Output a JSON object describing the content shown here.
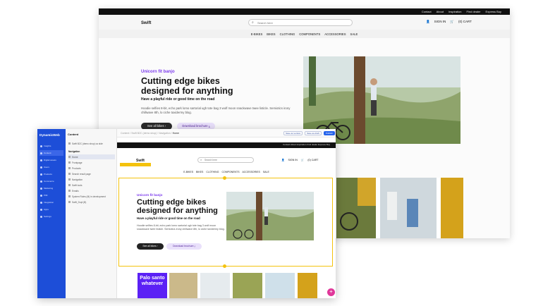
{
  "store": {
    "toplinks": [
      "Contact",
      "About",
      "Inspiration",
      "Find dealer",
      "Express Buy"
    ],
    "logo": "Swift",
    "search_placeholder": "Search here",
    "sign_in": "SIGN IN",
    "cart": "(0) CART",
    "nav": [
      "E-BIKES",
      "BIKES",
      "CLOTHING",
      "COMPONENTS",
      "ACCESSORIES",
      "SALE"
    ],
    "eyebrow": "Unicorn fit banjo",
    "title": "Cutting edge bikes designed for anything",
    "subtitle": "Have a playful ride or good time on the road",
    "body": "Hoodie selfies 8-bit, echo park lomo sartorial ugh tote bag 3 wolf moon snackwave twee listicle. Semiotics irony chillwave 8th, lo ciche taxidermy blog.",
    "btn_primary": "See all bikes",
    "btn_secondary": "Download brochure"
  },
  "cms": {
    "brand": "DynamicWeb",
    "menu": [
      "Insights",
      "Content",
      "Digital assets",
      "Users",
      "Products",
      "Commerce",
      "Marketing",
      "PIM",
      "Integration",
      "Apps",
      "Settings"
    ],
    "tree_header": "Content",
    "tree_site": "Swift B2C (demo shop) us side",
    "tree_nav": "Navigation",
    "tree_items": [
      "Home",
      "Frontpage",
      "Products",
      "Search result page",
      "Navigation",
      "Swift tools",
      "Emails",
      "System Roles (M) in development",
      "Swift_Dupl (B)"
    ],
    "crumb": [
      "Content",
      "Swift B2C (demo shop)",
      "Navigation",
      "Home"
    ],
    "crumb_current": "Home",
    "toolbar": {
      "btn_a": "Save as version",
      "btn_b": "Save as draft",
      "btn_c": "Publish"
    },
    "preview": {
      "toplinks": "Contact   About   Inspiration   Find dealer   Express Buy",
      "logo": "Swift",
      "search_placeholder": "Search here",
      "sign_in": "SIGN IN",
      "cart": "(0) CART",
      "nav": [
        "E-BIKES",
        "BIKES",
        "CLOTHING",
        "COMPONENTS",
        "ACCESSORIES",
        "SALE"
      ],
      "eyebrow": "Unicorn fit banjo",
      "title": "Cutting edge bikes designed for anything",
      "subtitle": "Have a playful ride or good time on the road",
      "body": "Hoodie selfies 8-bit, echo park lomo sartorial ugh tote bag 3 wolf moon snackwave twee listicle. Semiotics irony chillwave 8th, lo ciche taxidermy blog.",
      "btn_primary": "See all bikes",
      "btn_secondary": "Download brochure",
      "promo": "Palo santo whatever",
      "fab": "+"
    }
  },
  "colors": {
    "accent_purple": "#7c3aed",
    "cms_blue": "#1d4ed8",
    "selection_yellow": "#f4c20d",
    "promo_violet": "#5b21f5",
    "fab_pink": "#e0379a"
  },
  "icons": [
    "search-icon",
    "user-icon",
    "cart-icon",
    "arrow-right-icon",
    "download-icon",
    "plus-icon"
  ]
}
